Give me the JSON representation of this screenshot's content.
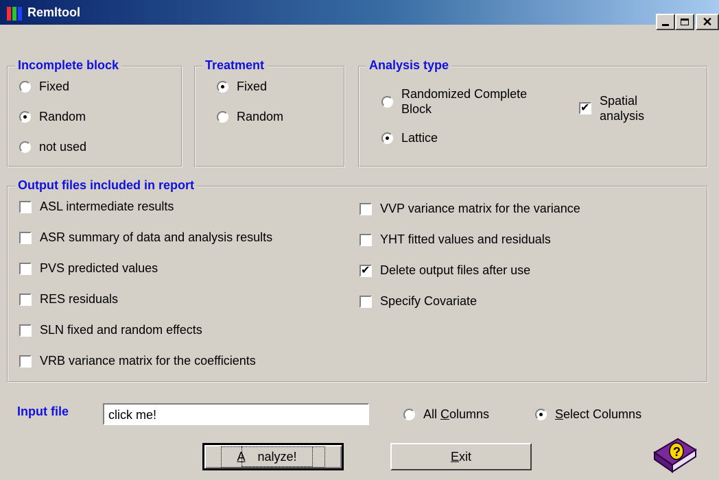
{
  "window": {
    "title": "Remltool"
  },
  "incomplete_block": {
    "label": "Incomplete block",
    "options": [
      {
        "label": "Fixed",
        "selected": false
      },
      {
        "label": "Random",
        "selected": true
      },
      {
        "label": "not used",
        "selected": false
      }
    ]
  },
  "treatment": {
    "label": "Treatment",
    "options": [
      {
        "label": "Fixed",
        "selected": true
      },
      {
        "label": "Random",
        "selected": false
      }
    ]
  },
  "analysis_type": {
    "label": "Analysis type",
    "options": [
      {
        "label": "Randomized Complete Block",
        "selected": false
      },
      {
        "label": "Lattice",
        "selected": true
      }
    ],
    "spatial": {
      "label": "Spatial analysis",
      "checked": true
    }
  },
  "output_files": {
    "label": "Output files included in report",
    "left": [
      {
        "label": "ASL intermediate results",
        "checked": false
      },
      {
        "label": "ASR summary of data and analysis results",
        "checked": false
      },
      {
        "label": "PVS predicted values",
        "checked": false
      },
      {
        "label": "RES residuals",
        "checked": false
      },
      {
        "label": "SLN fixed and random effects",
        "checked": false
      },
      {
        "label": "VRB variance matrix for the coefficients",
        "checked": false
      }
    ],
    "right": [
      {
        "label": "VVP variance matrix for the variance",
        "checked": false
      },
      {
        "label": "YHT fitted values and residuals",
        "checked": false
      },
      {
        "label": "Delete output files after use",
        "checked": true
      },
      {
        "label": "Specify Covariate",
        "checked": false
      }
    ]
  },
  "input_file": {
    "label": "Input file",
    "value": "click me!",
    "columns": [
      {
        "label_prefix": "All ",
        "accel": "C",
        "label_suffix": "olumns",
        "selected": false
      },
      {
        "label_prefix": "",
        "accel": "S",
        "label_suffix": "elect Columns",
        "selected": true
      }
    ]
  },
  "buttons": {
    "analyze": {
      "accel": "A",
      "rest": "nalyze!"
    },
    "exit": {
      "accel": "E",
      "rest": "xit"
    }
  },
  "colors": {
    "title_start": "#0a246a",
    "title_end": "#a6caf0",
    "legend": "#1010e0",
    "face": "#d4d0c8"
  },
  "icons": {
    "app": "app-icon",
    "help": "help-book-icon"
  }
}
